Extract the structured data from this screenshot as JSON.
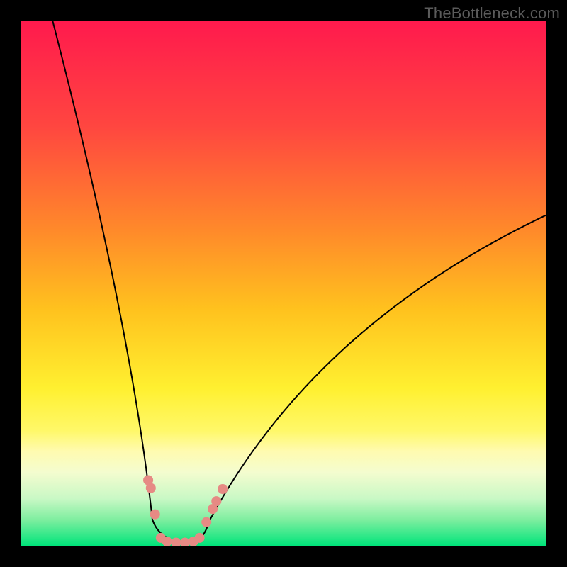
{
  "watermark": "TheBottleneck.com",
  "chart_data": {
    "type": "line",
    "title": "",
    "xlabel": "",
    "ylabel": "",
    "xlim": [
      0,
      100
    ],
    "ylim": [
      0,
      100
    ],
    "gradient_stops": [
      {
        "offset": 0.0,
        "color": "#ff1a4d"
      },
      {
        "offset": 0.2,
        "color": "#ff4640"
      },
      {
        "offset": 0.4,
        "color": "#ff8a2a"
      },
      {
        "offset": 0.55,
        "color": "#ffc21e"
      },
      {
        "offset": 0.7,
        "color": "#fff030"
      },
      {
        "offset": 0.78,
        "color": "#fff868"
      },
      {
        "offset": 0.82,
        "color": "#fffbb0"
      },
      {
        "offset": 0.86,
        "color": "#f4fccf"
      },
      {
        "offset": 0.91,
        "color": "#c9f8c5"
      },
      {
        "offset": 0.95,
        "color": "#7feea0"
      },
      {
        "offset": 1.0,
        "color": "#00e47a"
      }
    ],
    "series": [
      {
        "name": "curves",
        "stroke": "#000000",
        "stroke_width": 2,
        "segments": [
          {
            "x0": 6.0,
            "y0": 100.0,
            "cx": 21.0,
            "cy": 42.0,
            "x1": 25.0,
            "y1": 5.0
          },
          {
            "x0": 25.0,
            "y0": 5.0,
            "cx": 26.5,
            "cy": 0.5,
            "x1": 32.5,
            "y1": 0.5
          },
          {
            "x0": 32.5,
            "y0": 0.5,
            "cx": 34.5,
            "cy": 0.5,
            "x1": 36.0,
            "y1": 5.0
          },
          {
            "x0": 36.0,
            "y0": 5.0,
            "cx": 56.0,
            "cy": 42.0,
            "x1": 100.0,
            "y1": 63.0
          }
        ]
      }
    ],
    "markers": {
      "color": "#e68a84",
      "radius_pct": 0.95,
      "points": [
        {
          "x": 24.2,
          "y": 12.5
        },
        {
          "x": 24.7,
          "y": 11.0
        },
        {
          "x": 25.5,
          "y": 6.0
        },
        {
          "x": 26.6,
          "y": 1.5
        },
        {
          "x": 27.8,
          "y": 0.8
        },
        {
          "x": 29.5,
          "y": 0.6
        },
        {
          "x": 31.2,
          "y": 0.6
        },
        {
          "x": 32.8,
          "y": 0.8
        },
        {
          "x": 34.0,
          "y": 1.5
        },
        {
          "x": 35.3,
          "y": 4.5
        },
        {
          "x": 36.5,
          "y": 7.0
        },
        {
          "x": 37.2,
          "y": 8.5
        },
        {
          "x": 38.4,
          "y": 10.8
        }
      ]
    }
  }
}
